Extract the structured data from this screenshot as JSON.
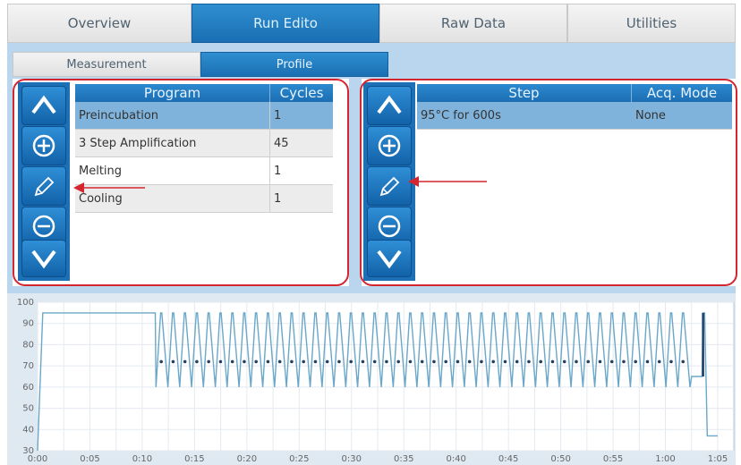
{
  "tabs": [
    {
      "label": "Overview",
      "active": false
    },
    {
      "label": "Run Edito",
      "active": true
    },
    {
      "label": "Raw Data",
      "active": false
    },
    {
      "label": "Utilities",
      "active": false
    }
  ],
  "subtabs": [
    {
      "label": "Measurement",
      "active": false
    },
    {
      "label": "Profile",
      "active": true
    }
  ],
  "program_table": {
    "headers": [
      "Program",
      "Cycles"
    ],
    "rows": [
      {
        "program": "Preincubation",
        "cycles": "1",
        "selected": true
      },
      {
        "program": "3 Step Amplification",
        "cycles": "45",
        "selected": false
      },
      {
        "program": "Melting",
        "cycles": "1",
        "selected": false
      },
      {
        "program": "Cooling",
        "cycles": "1",
        "selected": false
      }
    ]
  },
  "step_table": {
    "headers": [
      "Step",
      "Acq. Mode"
    ],
    "rows": [
      {
        "step": "95°C for 600s",
        "mode": "None",
        "selected": true
      }
    ]
  },
  "buttons": [
    "up-icon",
    "plus-circle-icon",
    "pencil-icon",
    "minus-circle-icon",
    "down-icon"
  ],
  "colors": {
    "accent": "#1d70b6",
    "highlight": "#d4262f",
    "selected_row": "#7fb3dc",
    "trace": "#6aa7c8"
  },
  "chart_data": {
    "type": "line",
    "ylim": [
      30,
      100
    ],
    "yticks": [
      "30",
      "40",
      "50",
      "60",
      "70",
      "80",
      "90",
      "100"
    ],
    "xticks": [
      "0:00",
      "0:05",
      "0:10",
      "0:15",
      "0:20",
      "0:25",
      "0:30",
      "0:35",
      "0:40",
      "0:45",
      "0:50",
      "0:55",
      "1:00",
      "1:05"
    ],
    "segments": {
      "preincubation": {
        "temp": 95,
        "start": "0:00",
        "end": "0:10"
      },
      "amplification": {
        "cycles": 45,
        "high": 95,
        "low": 60,
        "acquisition_temp": 72
      },
      "melting": {
        "from": 65,
        "to": 95
      },
      "cooling": {
        "temp": 37
      }
    }
  }
}
